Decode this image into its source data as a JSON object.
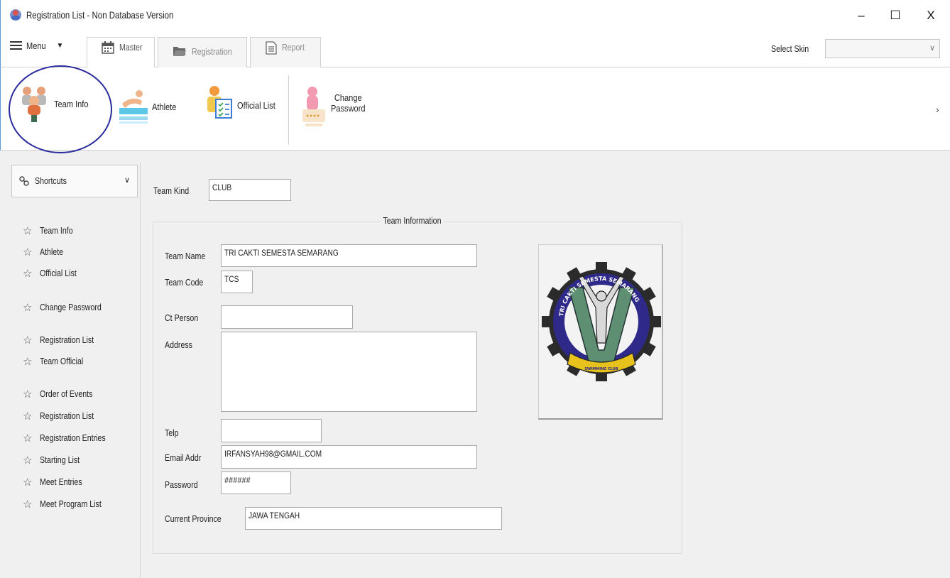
{
  "window": {
    "title": "Registration List - Non Database Version",
    "minimize_glyph": "–",
    "maximize_glyph": "☐",
    "close_glyph": "X"
  },
  "tabs": {
    "menu_label": "Menu",
    "items": [
      {
        "label": "Master",
        "icon": "calendar-icon",
        "active": true
      },
      {
        "label": "Registration",
        "icon": "folder-icon",
        "active": false
      },
      {
        "label": "Report",
        "icon": "document-icon",
        "active": false
      }
    ],
    "skin_label": "Select Skin",
    "skin_value": ""
  },
  "ribbon": {
    "buttons": [
      {
        "label": "Team Info",
        "icon": "team-icon"
      },
      {
        "label": "Athlete",
        "icon": "swimmer-icon"
      },
      {
        "label": "Official List",
        "icon": "official-icon"
      },
      {
        "label": "Change\nPassword",
        "icon": "lock-icon"
      }
    ]
  },
  "sidebar": {
    "header": "Shortcuts",
    "items": [
      "Team Info",
      "Athlete",
      "Official List",
      "Change Password",
      "Registration List",
      "Team Official",
      "Order of Events",
      "Registration List",
      "Registration Entries",
      "Starting List",
      "Meet Entries",
      "Meet Program List"
    ]
  },
  "form": {
    "team_kind_label": "Team Kind",
    "team_kind_value": "CLUB",
    "group_title": "Team Information",
    "team_name_label": "Team Name",
    "team_name_value": "TRI CAKTI SEMESTA SEMARANG",
    "team_code_label": "Team Code",
    "team_code_value": "TCS",
    "ct_person_label": "Ct Person",
    "ct_person_value": "",
    "address_label": "Address",
    "address_value": "",
    "telp_label": "Telp",
    "telp_value": "",
    "email_label": "Email Addr",
    "email_value": "IRFANSYAH98@GMAIL.COM",
    "password_label": "Password",
    "password_value": "######",
    "province_label": "Current Province",
    "province_value": "JAWA TENGAH"
  },
  "logo": {
    "ring_text": "TRI CAKTI SEMESTA SEMARANG",
    "banner_text": "SWIMMING CLUB"
  },
  "colors": {
    "accent": "#5b9bd5",
    "highlight_circle": "#2b2b9e",
    "logo_navy": "#2f2a8a",
    "logo_green": "#5f8f72",
    "logo_gold": "#e8c21c"
  }
}
